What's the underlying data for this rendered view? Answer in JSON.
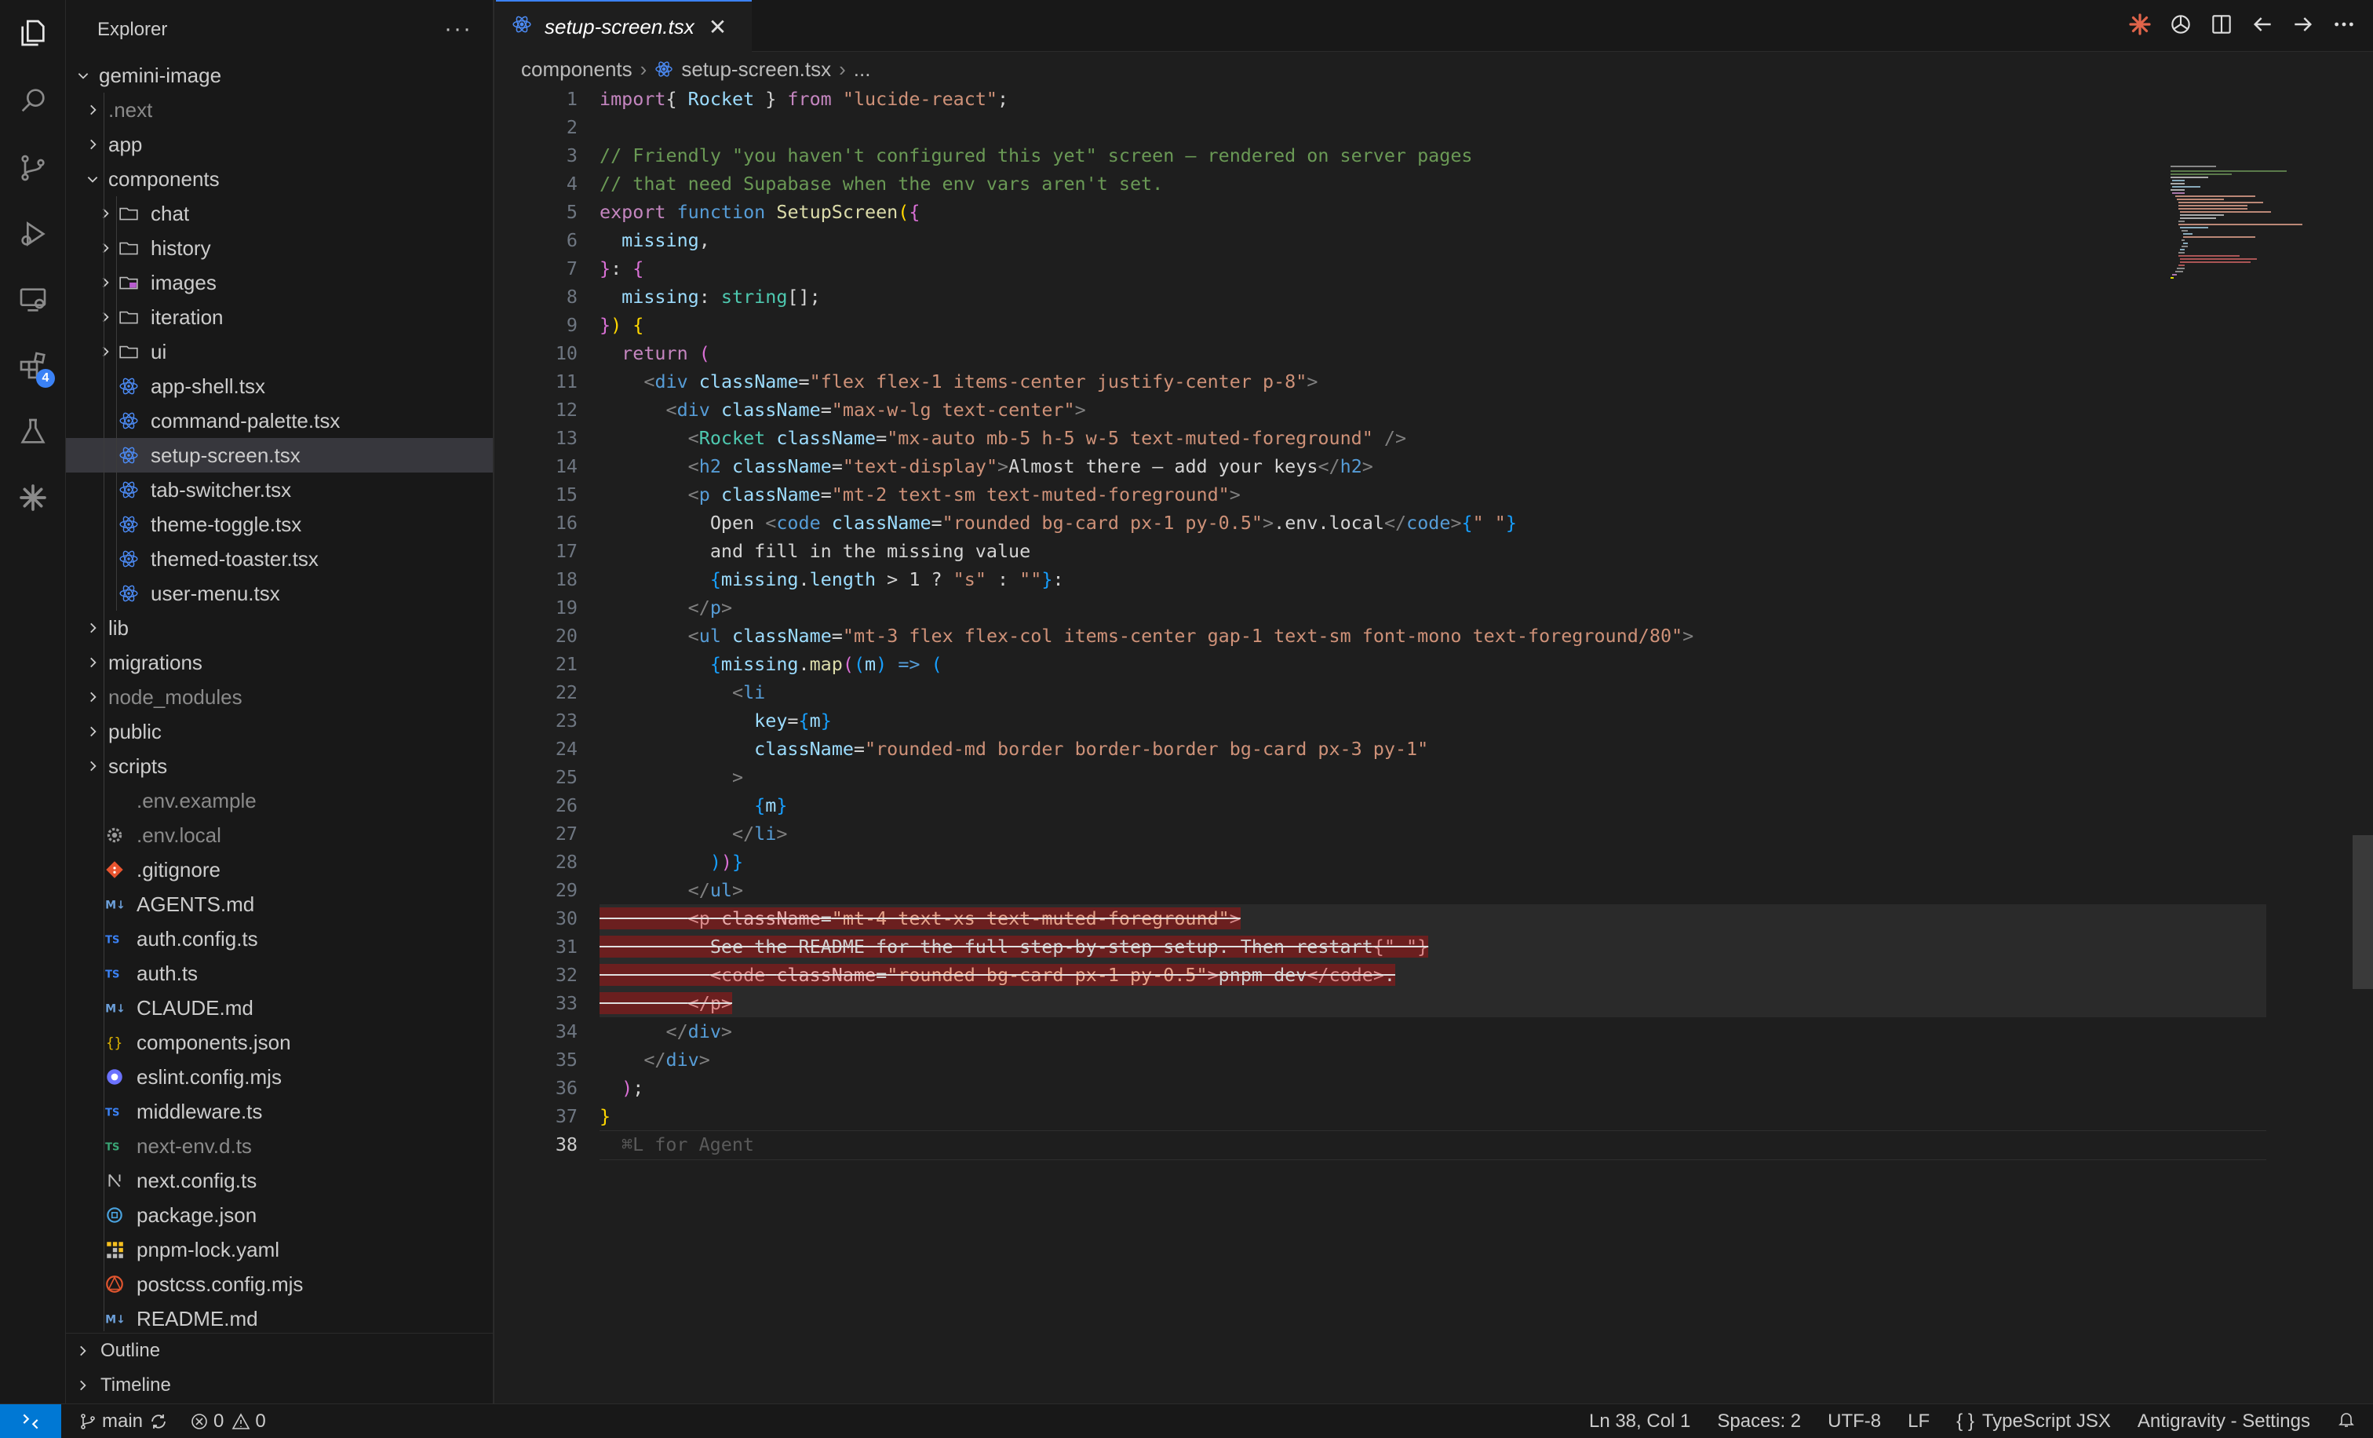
{
  "explorer": {
    "title": "Explorer",
    "more": "···",
    "root": "gemini-image"
  },
  "tree": [
    {
      "label": ".next",
      "type": "folder",
      "depth": 1,
      "dim": true,
      "icon": "folder-next-icon"
    },
    {
      "label": "app",
      "type": "folder",
      "depth": 1,
      "icon": "folder-app-icon"
    },
    {
      "label": "components",
      "type": "folder",
      "depth": 1,
      "open": true,
      "icon": "folder-components-icon"
    },
    {
      "label": "chat",
      "type": "folder",
      "depth": 2,
      "icon": "folder-icon"
    },
    {
      "label": "history",
      "type": "folder",
      "depth": 2,
      "icon": "folder-icon"
    },
    {
      "label": "images",
      "type": "folder",
      "depth": 2,
      "icon": "folder-images-icon"
    },
    {
      "label": "iteration",
      "type": "folder",
      "depth": 2,
      "icon": "folder-icon"
    },
    {
      "label": "ui",
      "type": "folder",
      "depth": 2,
      "icon": "folder-icon"
    },
    {
      "label": "app-shell.tsx",
      "type": "file",
      "depth": 2,
      "icon": "react-icon"
    },
    {
      "label": "command-palette.tsx",
      "type": "file",
      "depth": 2,
      "icon": "react-icon"
    },
    {
      "label": "setup-screen.tsx",
      "type": "file",
      "depth": 2,
      "icon": "react-icon",
      "selected": true
    },
    {
      "label": "tab-switcher.tsx",
      "type": "file",
      "depth": 2,
      "icon": "react-icon"
    },
    {
      "label": "theme-toggle.tsx",
      "type": "file",
      "depth": 2,
      "icon": "react-icon"
    },
    {
      "label": "themed-toaster.tsx",
      "type": "file",
      "depth": 2,
      "icon": "react-icon"
    },
    {
      "label": "user-menu.tsx",
      "type": "file",
      "depth": 2,
      "icon": "react-icon"
    },
    {
      "label": "lib",
      "type": "folder",
      "depth": 1,
      "icon": "folder-lib-icon"
    },
    {
      "label": "migrations",
      "type": "folder",
      "depth": 1,
      "icon": "folder-migrations-icon"
    },
    {
      "label": "node_modules",
      "type": "folder",
      "depth": 1,
      "dim": true,
      "icon": "folder-node-icon"
    },
    {
      "label": "public",
      "type": "folder",
      "depth": 1,
      "icon": "folder-public-icon"
    },
    {
      "label": "scripts",
      "type": "folder",
      "depth": 1,
      "icon": "folder-scripts-icon"
    },
    {
      "label": ".env.example",
      "type": "file",
      "depth": 1,
      "dim": true,
      "icon": "blank-icon"
    },
    {
      "label": ".env.local",
      "type": "file",
      "depth": 1,
      "dim": true,
      "icon": "gear-icon"
    },
    {
      "label": ".gitignore",
      "type": "file",
      "depth": 1,
      "icon": "git-icon"
    },
    {
      "label": "AGENTS.md",
      "type": "file",
      "depth": 1,
      "icon": "markdown-icon"
    },
    {
      "label": "auth.config.ts",
      "type": "file",
      "depth": 1,
      "icon": "ts-icon"
    },
    {
      "label": "auth.ts",
      "type": "file",
      "depth": 1,
      "icon": "ts-icon"
    },
    {
      "label": "CLAUDE.md",
      "type": "file",
      "depth": 1,
      "icon": "markdown-icon"
    },
    {
      "label": "components.json",
      "type": "file",
      "depth": 1,
      "icon": "json-icon"
    },
    {
      "label": "eslint.config.mjs",
      "type": "file",
      "depth": 1,
      "icon": "eslint-icon"
    },
    {
      "label": "middleware.ts",
      "type": "file",
      "depth": 1,
      "icon": "ts-icon"
    },
    {
      "label": "next-env.d.ts",
      "type": "file",
      "depth": 1,
      "dim": true,
      "icon": "ts-def-icon"
    },
    {
      "label": "next.config.ts",
      "type": "file",
      "depth": 1,
      "icon": "next-icon"
    },
    {
      "label": "package.json",
      "type": "file",
      "depth": 1,
      "icon": "npm-icon"
    },
    {
      "label": "pnpm-lock.yaml",
      "type": "file",
      "depth": 1,
      "icon": "pnpm-icon"
    },
    {
      "label": "postcss.config.mjs",
      "type": "file",
      "depth": 1,
      "icon": "postcss-icon"
    },
    {
      "label": "README.md",
      "type": "file",
      "depth": 1,
      "icon": "markdown-icon"
    }
  ],
  "sections": {
    "outline": "Outline",
    "timeline": "Timeline"
  },
  "tab": {
    "label": "setup-screen.tsx",
    "close": "✕"
  },
  "breadcrumb": {
    "folder": "components",
    "file": "setup-screen.tsx",
    "more": "..."
  },
  "code": {
    "current_line": 38,
    "ghost": "⌘L for Agent",
    "lines": [
      [
        [
          "k",
          "import"
        ],
        [
          "",
          "{ "
        ],
        [
          "v",
          "Rocket"
        ],
        [
          "",
          " } "
        ],
        [
          "k",
          "from"
        ],
        [
          "",
          " "
        ],
        [
          "s",
          "\"lucide-react\""
        ],
        [
          "",
          ";"
        ]
      ],
      [],
      [
        [
          "c",
          "// Friendly \"you haven't configured this yet\" screen — rendered on server pages"
        ]
      ],
      [
        [
          "c",
          "// that need Supabase when the env vars aren't set."
        ]
      ],
      [
        [
          "k",
          "export"
        ],
        [
          "",
          " "
        ],
        [
          "kb",
          "function"
        ],
        [
          "",
          " "
        ],
        [
          "f",
          "SetupScreen"
        ],
        [
          "y",
          "("
        ],
        [
          "p",
          "{"
        ]
      ],
      [
        [
          "",
          "  "
        ],
        [
          "v",
          "missing"
        ],
        [
          "",
          ","
        ]
      ],
      [
        [
          "p",
          "}"
        ],
        [
          "",
          ": "
        ],
        [
          "p",
          "{"
        ]
      ],
      [
        [
          "",
          "  "
        ],
        [
          "v",
          "missing"
        ],
        [
          "",
          ": "
        ],
        [
          "ty",
          "string"
        ],
        [
          "",
          "[];"
        ]
      ],
      [
        [
          "p",
          "}"
        ],
        [
          "y",
          ")"
        ],
        [
          "",
          " "
        ],
        [
          "y",
          "{"
        ]
      ],
      [
        [
          "",
          "  "
        ],
        [
          "k",
          "return"
        ],
        [
          "",
          " "
        ],
        [
          "p",
          "("
        ]
      ],
      [
        [
          "",
          "    "
        ],
        [
          "tg",
          "<"
        ],
        [
          "t",
          "div"
        ],
        [
          "",
          " "
        ],
        [
          "a",
          "className"
        ],
        [
          "",
          "="
        ],
        [
          "s",
          "\"flex flex-1 items-center justify-center p-8\""
        ],
        [
          "tg",
          ">"
        ]
      ],
      [
        [
          "",
          "      "
        ],
        [
          "tg",
          "<"
        ],
        [
          "t",
          "div"
        ],
        [
          "",
          " "
        ],
        [
          "a",
          "className"
        ],
        [
          "",
          "="
        ],
        [
          "s",
          "\"max-w-lg text-center\""
        ],
        [
          "tg",
          ">"
        ]
      ],
      [
        [
          "",
          "        "
        ],
        [
          "tg",
          "<"
        ],
        [
          "cp",
          "Rocket"
        ],
        [
          "",
          " "
        ],
        [
          "a",
          "className"
        ],
        [
          "",
          "="
        ],
        [
          "s",
          "\"mx-auto mb-5 h-5 w-5 text-muted-foreground\""
        ],
        [
          "",
          " "
        ],
        [
          "tg",
          "/>"
        ]
      ],
      [
        [
          "",
          "        "
        ],
        [
          "tg",
          "<"
        ],
        [
          "t",
          "h2"
        ],
        [
          "",
          " "
        ],
        [
          "a",
          "className"
        ],
        [
          "",
          "="
        ],
        [
          "s",
          "\"text-display\""
        ],
        [
          "tg",
          ">"
        ],
        [
          "",
          "Almost there — add your keys"
        ],
        [
          "tg",
          "</"
        ],
        [
          "t",
          "h2"
        ],
        [
          "tg",
          ">"
        ]
      ],
      [
        [
          "",
          "        "
        ],
        [
          "tg",
          "<"
        ],
        [
          "t",
          "p"
        ],
        [
          "",
          " "
        ],
        [
          "a",
          "className"
        ],
        [
          "",
          "="
        ],
        [
          "s",
          "\"mt-2 text-sm text-muted-foreground\""
        ],
        [
          "tg",
          ">"
        ]
      ],
      [
        [
          "",
          "          Open "
        ],
        [
          "tg",
          "<"
        ],
        [
          "t",
          "code"
        ],
        [
          "",
          " "
        ],
        [
          "a",
          "className"
        ],
        [
          "",
          "="
        ],
        [
          "s",
          "\"rounded bg-card px-1 py-0.5\""
        ],
        [
          "tg",
          ">"
        ],
        [
          "",
          ".env.local"
        ],
        [
          "tg",
          "</"
        ],
        [
          "t",
          "code"
        ],
        [
          "tg",
          ">"
        ],
        [
          "bl",
          "{"
        ],
        [
          "s",
          "\" \""
        ],
        [
          "bl",
          "}"
        ]
      ],
      [
        [
          "",
          "          and fill in the missing value"
        ]
      ],
      [
        [
          "",
          "          "
        ],
        [
          "bl",
          "{"
        ],
        [
          "v",
          "missing"
        ],
        [
          "",
          "."
        ],
        [
          "v",
          "length"
        ],
        [
          "",
          " > 1 ? "
        ],
        [
          "s",
          "\"s\""
        ],
        [
          "",
          " : "
        ],
        [
          "s",
          "\"\""
        ],
        [
          "bl",
          "}"
        ],
        [
          "",
          ":"
        ]
      ],
      [
        [
          "",
          "        "
        ],
        [
          "tg",
          "</"
        ],
        [
          "t",
          "p"
        ],
        [
          "tg",
          ">"
        ]
      ],
      [
        [
          "",
          "        "
        ],
        [
          "tg",
          "<"
        ],
        [
          "t",
          "ul"
        ],
        [
          "",
          " "
        ],
        [
          "a",
          "className"
        ],
        [
          "",
          "="
        ],
        [
          "s",
          "\"mt-3 flex flex-col items-center gap-1 text-sm font-mono text-foreground/80\""
        ],
        [
          "tg",
          ">"
        ]
      ],
      [
        [
          "",
          "          "
        ],
        [
          "bl",
          "{"
        ],
        [
          "v",
          "missing"
        ],
        [
          "",
          "."
        ],
        [
          "f",
          "map"
        ],
        [
          "p",
          "("
        ],
        [
          "bl",
          "("
        ],
        [
          "v",
          "m"
        ],
        [
          "bl",
          ")"
        ],
        [
          "",
          " "
        ],
        [
          "kb",
          "=>"
        ],
        [
          "",
          " "
        ],
        [
          "bl",
          "("
        ]
      ],
      [
        [
          "",
          "            "
        ],
        [
          "tg",
          "<"
        ],
        [
          "t",
          "li"
        ]
      ],
      [
        [
          "",
          "              "
        ],
        [
          "a",
          "key"
        ],
        [
          "",
          "="
        ],
        [
          "bl",
          "{"
        ],
        [
          "v",
          "m"
        ],
        [
          "bl",
          "}"
        ]
      ],
      [
        [
          "",
          "              "
        ],
        [
          "a",
          "className"
        ],
        [
          "",
          "="
        ],
        [
          "s",
          "\"rounded-md border border-border bg-card px-3 py-1\""
        ]
      ],
      [
        [
          "",
          "            "
        ],
        [
          "tg",
          ">"
        ]
      ],
      [
        [
          "",
          "              "
        ],
        [
          "bl",
          "{"
        ],
        [
          "v",
          "m"
        ],
        [
          "bl",
          "}"
        ]
      ],
      [
        [
          "",
          "            "
        ],
        [
          "tg",
          "</"
        ],
        [
          "t",
          "li"
        ],
        [
          "tg",
          ">"
        ]
      ],
      [
        [
          "",
          "          "
        ],
        [
          "bl",
          ")"
        ],
        [
          "p",
          ")"
        ],
        [
          "bl",
          "}"
        ]
      ],
      [
        [
          "",
          "        "
        ],
        [
          "tg",
          "</"
        ],
        [
          "t",
          "ul"
        ],
        [
          "tg",
          ">"
        ]
      ],
      [
        [
          "DEL",
          "        "
        ],
        [
          "DEL:t",
          "<p"
        ],
        [
          "DEL",
          " "
        ],
        [
          "DEL:a",
          "className"
        ],
        [
          "DEL",
          "="
        ],
        [
          "DEL:s",
          "\"mt-4 text-xs text-muted-foreground\""
        ],
        [
          "DEL:t",
          ">"
        ]
      ],
      [
        [
          "DEL",
          "          See the README for the full step-by-step setup. Then restart"
        ],
        [
          "DEL:t",
          "{\" \"}"
        ]
      ],
      [
        [
          "DEL",
          "          "
        ],
        [
          "DEL:t",
          "<code"
        ],
        [
          "DEL",
          " "
        ],
        [
          "DEL:a",
          "className"
        ],
        [
          "DEL",
          "="
        ],
        [
          "DEL:s",
          "\"rounded bg-card px-1 py-0.5\""
        ],
        [
          "DEL:t",
          ">"
        ],
        [
          "DEL",
          "pnpm dev"
        ],
        [
          "DEL:t",
          "</code>"
        ],
        [
          "DEL",
          "."
        ]
      ],
      [
        [
          "DEL",
          "        "
        ],
        [
          "DEL:t",
          "</p>"
        ]
      ],
      [
        [
          "",
          "      "
        ],
        [
          "tg",
          "</"
        ],
        [
          "t",
          "div"
        ],
        [
          "tg",
          ">"
        ]
      ],
      [
        [
          "",
          "    "
        ],
        [
          "tg",
          "</"
        ],
        [
          "t",
          "div"
        ],
        [
          "tg",
          ">"
        ]
      ],
      [
        [
          "",
          "  "
        ],
        [
          "p",
          ")"
        ],
        [
          "",
          ";"
        ]
      ],
      [
        [
          "y",
          "}"
        ]
      ],
      []
    ]
  },
  "status": {
    "branch": "main",
    "errors": "0",
    "warnings": "0",
    "position": "Ln 38, Col 1",
    "spaces": "Spaces: 2",
    "encoding": "UTF-8",
    "eol": "LF",
    "language": "TypeScript JSX",
    "settings": "Antigravity - Settings",
    "language_icon": "{ }"
  },
  "activity_badge": "4",
  "colors": {
    "accent": "#3b82f6",
    "remote": "#0078d4",
    "deleted": "#6b1f1f"
  }
}
